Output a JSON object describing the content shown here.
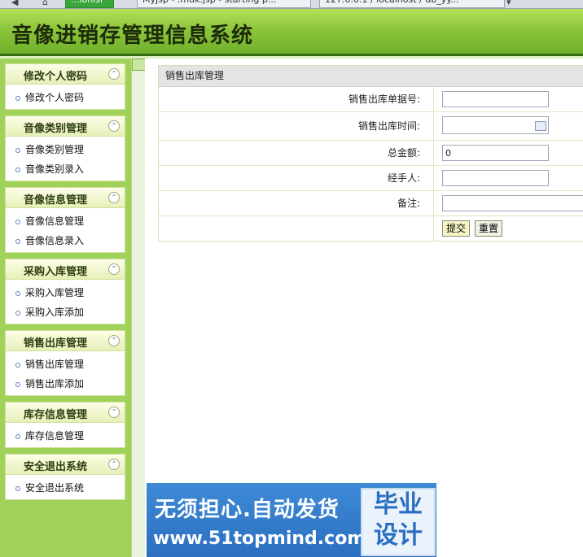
{
  "browser": {
    "tabs": [
      {
        "label": "...ionlsl",
        "active": true
      },
      {
        "label": "MyJsp - .mdk.jsp - starting p...",
        "active": false
      },
      {
        "label": "127.0.0.1 / localhost / db_yy...",
        "active": false
      }
    ]
  },
  "header": {
    "title": "音像进销存管理信息系统"
  },
  "sidebar": {
    "groups": [
      {
        "title": "修改个人密码",
        "items": [
          "修改个人密码"
        ]
      },
      {
        "title": "音像类别管理",
        "items": [
          "音像类别管理",
          "音像类别录入"
        ]
      },
      {
        "title": "音像信息管理",
        "items": [
          "音像信息管理",
          "音像信息录入"
        ]
      },
      {
        "title": "采购入库管理",
        "items": [
          "采购入库管理",
          "采购入库添加"
        ]
      },
      {
        "title": "销售出库管理",
        "items": [
          "销售出库管理",
          "销售出库添加"
        ]
      },
      {
        "title": "库存信息管理",
        "items": [
          "库存信息管理"
        ]
      },
      {
        "title": "安全退出系统",
        "items": [
          "安全退出系统"
        ]
      }
    ]
  },
  "form": {
    "title": "销售出库管理",
    "fields": [
      {
        "label": "销售出库单据号:",
        "value": "",
        "type": "text"
      },
      {
        "label": "销售出库时间:",
        "value": "",
        "type": "date"
      },
      {
        "label": "总金额:",
        "value": "0",
        "type": "text"
      },
      {
        "label": "经手人:",
        "value": "",
        "type": "text"
      },
      {
        "label": "备注:",
        "value": "",
        "type": "text"
      }
    ],
    "submit_label": "提交",
    "reset_label": "重置"
  },
  "watermark": {
    "line1": "无须担心.自动发货",
    "line2": "www.51topmind.com",
    "badge_top": "毕业",
    "badge_bottom": "设计"
  }
}
